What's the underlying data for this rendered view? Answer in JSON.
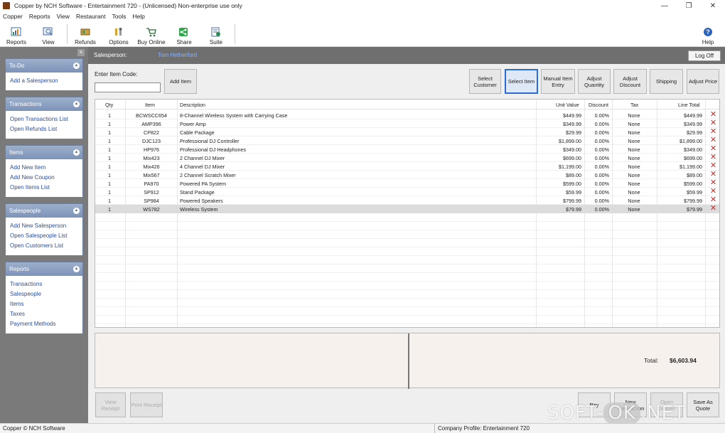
{
  "window": {
    "title": "Copper by NCH Software - Entertainment 720 - (Unlicensed) Non-enterprise use only",
    "controls": [
      "—",
      "❐",
      "✕"
    ]
  },
  "menu": [
    "Copper",
    "Reports",
    "View",
    "Restaurant",
    "Tools",
    "Help"
  ],
  "toolbar": {
    "reports": "Reports",
    "view": "View",
    "refunds": "Refunds",
    "options": "Options",
    "buy_online": "Buy Online",
    "share": "Share",
    "suite": "Suite",
    "help": "Help"
  },
  "sidebar": {
    "panels": [
      {
        "title": "To-Do",
        "links": [
          "Add a Salesperson"
        ]
      },
      {
        "title": "Transactions",
        "links": [
          "Open Transactions List",
          "Open Refunds List"
        ]
      },
      {
        "title": "Items",
        "links": [
          "Add New Item",
          "Add New Coupon",
          "Open Items List"
        ]
      },
      {
        "title": "Salespeople",
        "links": [
          "Add New Salesperson",
          "Open Salespeople List",
          "Open Customers List"
        ]
      },
      {
        "title": "Reports",
        "links": [
          "Transactions",
          "Salespeople",
          "Items",
          "Taxes",
          "Payment Methods"
        ]
      }
    ]
  },
  "header": {
    "salesperson_label": "Salesperson:",
    "salesperson_value": "Tom Hetherford",
    "logoff": "Log Off"
  },
  "entry": {
    "item_code_label": "Enter Item Code:",
    "item_code_value": "",
    "add_item": "Add Item"
  },
  "actions": {
    "select_customer": "Select Customer",
    "select_item": "Select Item",
    "manual_item_entry": "Manual Item Entry",
    "adjust_quantity": "Adjust Quantity",
    "adjust_discount": "Adjust Discount",
    "shipping": "Shipping",
    "adjust_price": "Adjust Price"
  },
  "table": {
    "columns": [
      "Qty",
      "Item",
      "Description",
      "Unit Value",
      "Discount",
      "Tax",
      "Line Total"
    ],
    "rows": [
      [
        "1",
        "BCWSCC654",
        "8-Channel Wireless System with Carrying Case",
        "$449.99",
        "0.00%",
        "None",
        "$449.99"
      ],
      [
        "1",
        "AMP396",
        "Power Amp",
        "$349.99",
        "0.00%",
        "None",
        "$349.99"
      ],
      [
        "1",
        "CP822",
        "Cable Package",
        "$29.99",
        "0.00%",
        "None",
        "$29.99"
      ],
      [
        "1",
        "DJC123",
        "Professional DJ Controller",
        "$1,899.00",
        "0.00%",
        "None",
        "$1,899.00"
      ],
      [
        "1",
        "HP976",
        "Professional DJ Headphones",
        "$349.00",
        "0.00%",
        "None",
        "$349.00"
      ],
      [
        "1",
        "Mix423",
        "2 Channel DJ Mixer",
        "$699.00",
        "0.00%",
        "None",
        "$699.00"
      ],
      [
        "1",
        "Mix426",
        "4 Channel DJ Mixer",
        "$1,199.00",
        "0.00%",
        "None",
        "$1,199.00"
      ],
      [
        "1",
        "Mix567",
        "2 Channel Scratch Mixer",
        "$89.00",
        "0.00%",
        "None",
        "$89.00"
      ],
      [
        "1",
        "PA970",
        "Powered PA System",
        "$599.00",
        "0.00%",
        "None",
        "$599.00"
      ],
      [
        "1",
        "SP912",
        "Stand Package",
        "$59.99",
        "0.00%",
        "None",
        "$59.99"
      ],
      [
        "1",
        "SP984",
        "Powered Speakers",
        "$799.99",
        "0.00%",
        "None",
        "$799.99"
      ],
      [
        "1",
        "WS782",
        "Wireless System",
        "$79.99",
        "0.00%",
        "None",
        "$79.99"
      ]
    ],
    "selected_row_index": 11
  },
  "totals": {
    "label": "Total:",
    "value": "$6,603.94"
  },
  "bottom_buttons": {
    "view_receipt": "View Receipt",
    "print_receipt": "Print Receipt",
    "pay": "Pay",
    "new_transaction": "New Transaction",
    "open_drawer": "Open Drawer",
    "save_as_quote": "Save As Quote"
  },
  "status": {
    "left": "Copper © NCH Software",
    "right": "Company Profile: Entertainment 720"
  },
  "watermark": {
    "part1": "SOFT-",
    "part2": "OK",
    "part3": ".NET"
  },
  "colors": {
    "sidebar_bg": "#7a7a7a",
    "panel_header": "#8aa0c4",
    "link": "#2a4f9e",
    "delete_icon": "#c0302a",
    "active_button_border": "#2a6cd1"
  }
}
